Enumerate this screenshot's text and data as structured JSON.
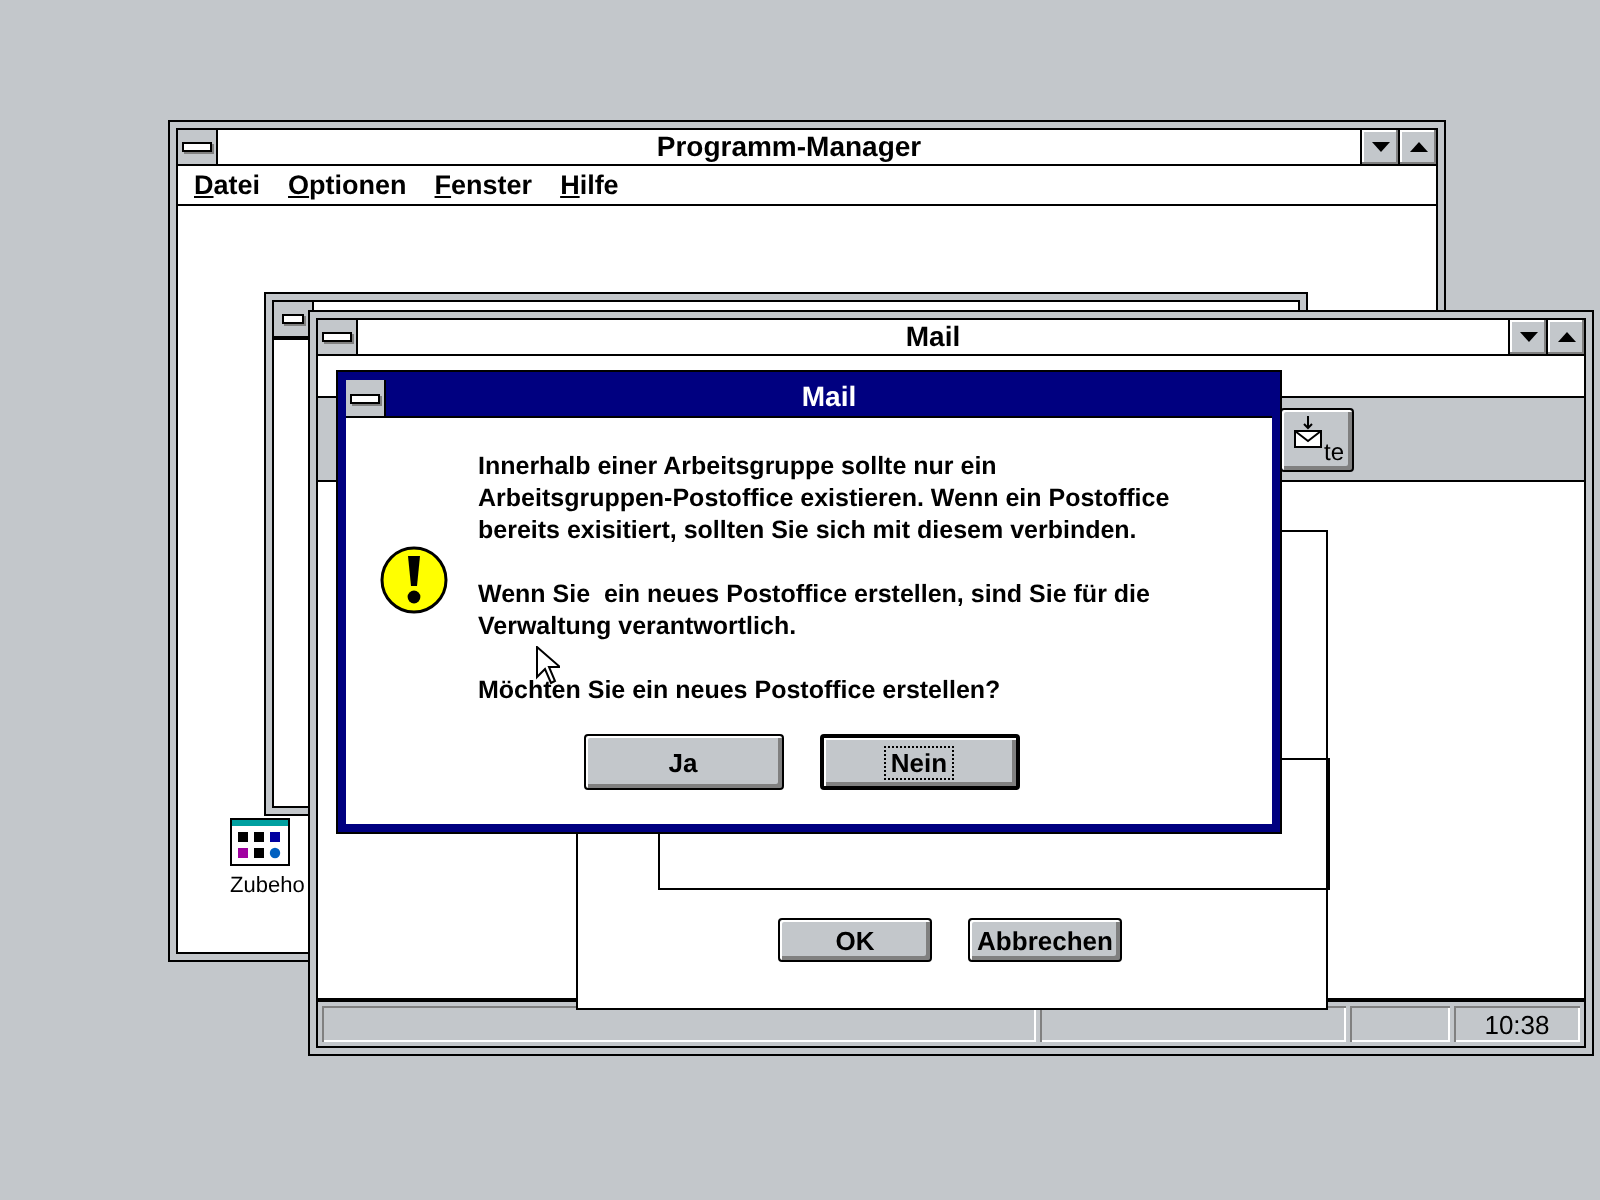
{
  "desktop": {
    "icons": [
      {
        "label": "Zubeho"
      }
    ]
  },
  "program_manager": {
    "title": "Programm-Manager",
    "menu": [
      {
        "label": "Datei"
      },
      {
        "label": "Optionen"
      },
      {
        "label": "Fenster"
      },
      {
        "label": "Hilfe"
      }
    ]
  },
  "mail_window": {
    "title": "Mail",
    "toolbar": {
      "button_text": "te"
    },
    "setup_dialog": {
      "buttons": [
        {
          "label": "OK"
        },
        {
          "label": "Abbrechen"
        }
      ]
    },
    "status_bar": {
      "time": "10:38"
    }
  },
  "message_box": {
    "title": "Mail",
    "paragraphs": [
      "Innerhalb einer Arbeitsgruppe sollte nur ein\nArbeitsgruppen-Postoffice existieren. Wenn ein Postoffice\nbereits exisitiert, sollten Sie sich mit diesem verbinden.",
      "Wenn Sie  ein neues Postoffice erstellen, sind Sie für die\nVerwaltung verantwortlich.",
      "Möchten Sie ein neues Postoffice erstellen?"
    ],
    "buttons": [
      {
        "label": "Ja",
        "default": false
      },
      {
        "label": "Nein",
        "default": true
      }
    ]
  }
}
